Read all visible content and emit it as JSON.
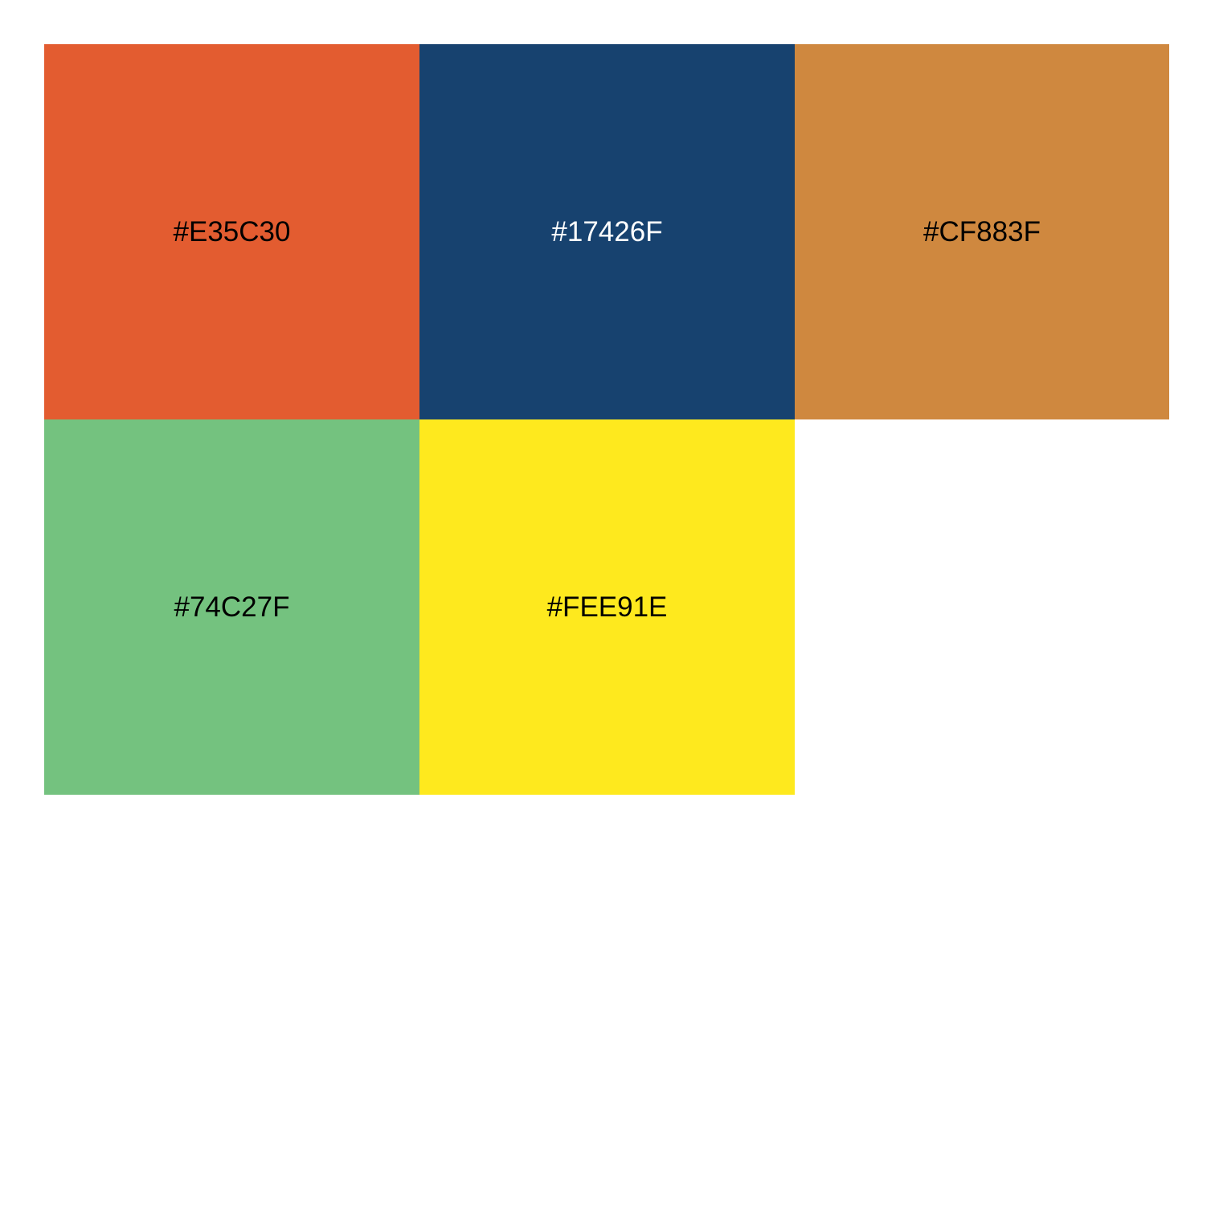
{
  "swatches": [
    {
      "label": "#E35C30",
      "color": "#E35C30",
      "text_color": "#000000"
    },
    {
      "label": "#17426F",
      "color": "#17426F",
      "text_color": "#FFFFFF"
    },
    {
      "label": "#CF883F",
      "color": "#CF883F",
      "text_color": "#000000"
    },
    {
      "label": "#74C27F",
      "color": "#74C27F",
      "text_color": "#000000"
    },
    {
      "label": "#FEE91E",
      "color": "#FEE91E",
      "text_color": "#000000"
    }
  ]
}
